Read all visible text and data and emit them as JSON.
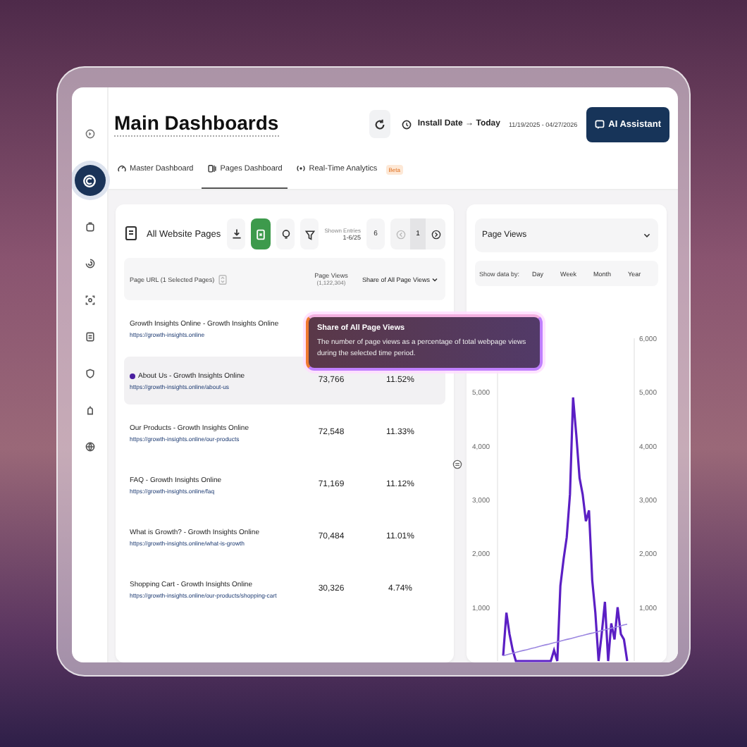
{
  "sidebar": {
    "items": [
      {
        "selected": false
      },
      {
        "selected": true
      },
      {
        "selected": false
      },
      {
        "selected": false
      },
      {
        "selected": false
      },
      {
        "selected": false
      },
      {
        "selected": false
      },
      {
        "selected": false
      },
      {
        "selected": false
      }
    ]
  },
  "header": {
    "title": "Main Dashboards",
    "range_label": "Install Date → Today",
    "range_dates": "11/19/2025 - 04/27/2026",
    "ai_button": "AI Assistant"
  },
  "tabs": [
    {
      "label": "Master Dashboard",
      "selected": false
    },
    {
      "label": "Pages Dashboard",
      "selected": true
    },
    {
      "label": "Real-Time Analytics",
      "selected": false,
      "badge": "Beta"
    }
  ],
  "table_card": {
    "title": "All Website Pages",
    "shown_entries_label": "Shown Entries",
    "shown_entries": "1-6/25",
    "page_size": "6",
    "page": "1",
    "columns": [
      {
        "label": "Page URL (1 Selected Pages)"
      },
      {
        "label": "Page Views",
        "sub": "(1,122,304)"
      },
      {
        "label": "Share of All Page Views"
      }
    ],
    "rows": [
      {
        "title": "Growth Insights Online - Growth Insights Online",
        "url": "https://growth-insights.online",
        "selected": false
      },
      {
        "title": "About Us - Growth Insights Online",
        "url": "https://growth-insights.online/about-us",
        "views": "73,766",
        "share": "11.52%",
        "selected": true
      },
      {
        "title": "Our Products - Growth Insights Online",
        "url": "https://growth-insights.online/our-products",
        "views": "72,548",
        "share": "11.33%",
        "selected": false
      },
      {
        "title": "FAQ - Growth Insights Online",
        "url": "https://growth-insights.online/faq",
        "views": "71,169",
        "share": "11.12%",
        "selected": false
      },
      {
        "title": "What is Growth? - Growth Insights Online",
        "url": "https://growth-insights.online/what-is-growth",
        "views": "70,484",
        "share": "11.01%",
        "selected": false
      },
      {
        "title": "Shopping Cart - Growth Insights Online",
        "url": "https://growth-insights.online/our-products/shopping-cart",
        "views": "30,326",
        "share": "4.74%",
        "selected": false
      }
    ]
  },
  "tooltip": {
    "title": "Share of All Page Views",
    "text": "The number of page views as a percentage of total webpage views during the selected time period."
  },
  "chart_card": {
    "show_by_label": "Show data by:",
    "periods": [
      "Day",
      "Week",
      "Month",
      "Year"
    ],
    "left_axis_labels": [
      "5,000",
      "4,000",
      "3,000",
      "2,000",
      "1,000"
    ],
    "chart_data": {
      "type": "line",
      "categories": [
        null,
        null,
        null,
        null,
        null,
        null,
        null,
        null,
        null,
        null,
        null,
        null,
        null,
        null,
        null,
        null,
        null,
        null,
        null,
        null,
        null,
        null,
        null,
        null,
        null,
        null,
        null,
        null,
        null,
        null,
        null,
        null,
        null,
        null,
        null,
        null,
        null,
        null,
        null,
        null
      ],
      "yticks": [
        {
          "value": 1000,
          "label": "1,000"
        },
        {
          "value": 2000,
          "label": "2,000"
        },
        {
          "value": 3000,
          "label": "3,000"
        },
        {
          "value": 4000,
          "label": "4,000"
        },
        {
          "value": 5000,
          "label": "5,000"
        },
        {
          "value": 6000,
          "label": "6,000"
        }
      ],
      "ylim": [
        0,
        6000
      ],
      "series": [
        {
          "name": "Page Views",
          "color": "#5b1fc4",
          "values": [
            100,
            900,
            500,
            200,
            0,
            0,
            0,
            0,
            0,
            0,
            0,
            0,
            0,
            0,
            0,
            0,
            200,
            0,
            1400,
            1900,
            2300,
            3100,
            4900,
            4200,
            3400,
            3100,
            2600,
            2800,
            1500,
            900,
            0,
            500,
            1100,
            0,
            700,
            400,
            1000,
            500,
            400,
            0
          ]
        },
        {
          "color": "#9b86e0",
          "values": [
            100,
            115,
            130,
            145,
            160,
            175,
            190,
            205,
            220,
            235,
            250,
            265,
            280,
            295,
            310,
            325,
            340,
            355,
            370,
            385,
            400,
            415,
            430,
            445,
            460,
            475,
            490,
            505,
            520,
            535,
            550,
            565,
            580,
            595,
            610,
            625,
            640,
            655,
            670,
            685
          ]
        }
      ]
    }
  }
}
